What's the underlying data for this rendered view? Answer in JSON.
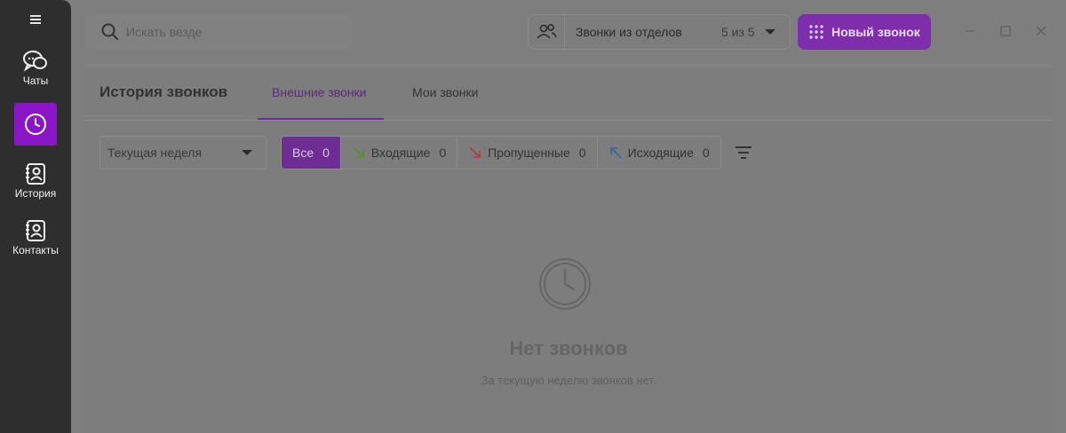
{
  "sidebar": {
    "items": [
      {
        "label": "Чаты",
        "icon": "chat-icon"
      },
      {
        "label": "",
        "icon": "clock-icon",
        "active": true
      },
      {
        "label": "История",
        "icon": "history-contact-icon"
      },
      {
        "label": "Контакты",
        "icon": "contacts-icon"
      }
    ]
  },
  "header": {
    "search_placeholder": "Искать везде",
    "dept_label": "Звонки из отделов",
    "dept_count": "5 из 5",
    "new_call_label": "Новый звонок"
  },
  "panel": {
    "title": "История звонков",
    "tabs": [
      {
        "label": "Внешние звонки",
        "active": true
      },
      {
        "label": "Мои звонки",
        "active": false
      }
    ],
    "period": "Текущая неделя",
    "filters": [
      {
        "label": "Все",
        "count": "0",
        "active": true
      },
      {
        "label": "Входящие",
        "count": "0",
        "icon": "incoming-arrow-icon"
      },
      {
        "label": "Пропущенные",
        "count": "0",
        "icon": "missed-arrow-icon"
      },
      {
        "label": "Исходящие",
        "count": "0",
        "icon": "outgoing-arrow-icon"
      }
    ],
    "empty_title": "Нет звонков",
    "empty_subtitle": "За текущую неделю звонков нет."
  },
  "colors": {
    "accent": "#8a16c8",
    "incoming": "#5a8a3a",
    "missed": "#a04a4a",
    "outgoing": "#3a6a9a"
  }
}
